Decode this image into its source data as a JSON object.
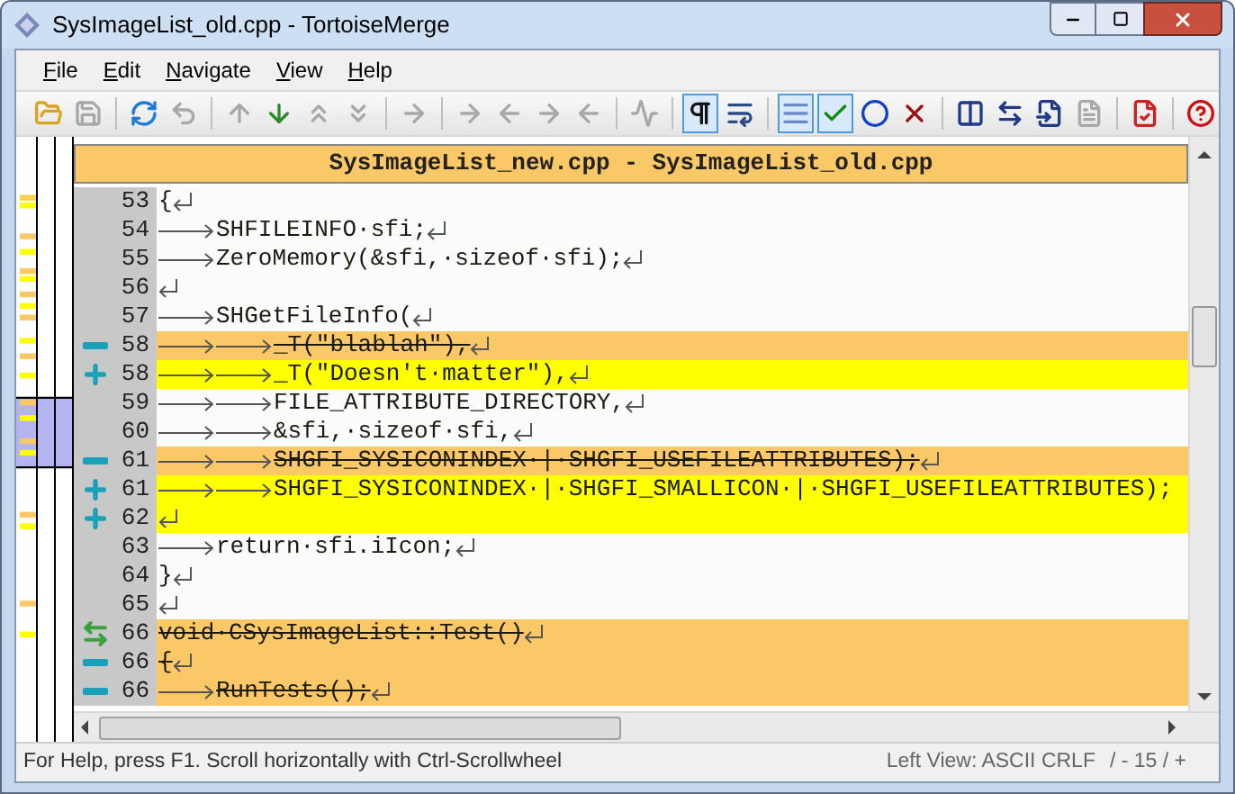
{
  "window": {
    "title": "SysImageList_old.cpp - TortoiseMerge"
  },
  "menu": [
    "File",
    "Edit",
    "Navigate",
    "View",
    "Help"
  ],
  "toolbar": [
    [
      {
        "kind": "open",
        "disabled": false,
        "selected": false
      },
      {
        "kind": "save",
        "disabled": true,
        "selected": false
      }
    ],
    [
      {
        "kind": "refresh",
        "disabled": false,
        "selected": false
      },
      {
        "kind": "undo",
        "disabled": true,
        "selected": false
      }
    ],
    [
      {
        "kind": "up",
        "disabled": true,
        "selected": false
      },
      {
        "kind": "down",
        "disabled": false,
        "selected": false
      },
      {
        "kind": "up-double",
        "disabled": true,
        "selected": false
      },
      {
        "kind": "down-double",
        "disabled": true,
        "selected": false
      }
    ],
    [
      {
        "kind": "right",
        "disabled": true,
        "selected": false
      }
    ],
    [
      {
        "kind": "right",
        "disabled": true,
        "selected": false
      },
      {
        "kind": "left",
        "disabled": true,
        "selected": false
      },
      {
        "kind": "right",
        "disabled": true,
        "selected": false
      },
      {
        "kind": "left",
        "disabled": true,
        "selected": false
      }
    ],
    [
      {
        "kind": "wave",
        "disabled": true,
        "selected": false
      }
    ],
    [
      {
        "kind": "pilcrow",
        "disabled": false,
        "selected": true
      },
      {
        "kind": "wrap",
        "disabled": false,
        "selected": false
      }
    ],
    [
      {
        "kind": "lines",
        "disabled": false,
        "selected": true
      },
      {
        "kind": "check",
        "disabled": false,
        "selected": true
      },
      {
        "kind": "circle",
        "disabled": false,
        "selected": false
      },
      {
        "kind": "cross",
        "disabled": false,
        "selected": false
      }
    ],
    [
      {
        "kind": "columns",
        "disabled": false,
        "selected": false
      },
      {
        "kind": "swap",
        "disabled": false,
        "selected": false
      },
      {
        "kind": "import",
        "disabled": false,
        "selected": false
      },
      {
        "kind": "page",
        "disabled": true,
        "selected": false
      }
    ],
    [
      {
        "kind": "doc-check",
        "disabled": false,
        "selected": false
      }
    ],
    [
      {
        "kind": "help",
        "disabled": false,
        "selected": false
      }
    ]
  ],
  "view": {
    "header": "SysImageList_new.cpp - SysImageList_old.cpp",
    "lines": [
      {
        "number": "53",
        "kind": "normal",
        "text": "{",
        "eol": true
      },
      {
        "number": "54",
        "kind": "normal",
        "text": "\tSHFILEINFO·sfi;",
        "eol": true
      },
      {
        "number": "55",
        "kind": "normal",
        "text": "\tZeroMemory(&sfi,·sizeof·sfi);",
        "eol": true
      },
      {
        "number": "56",
        "kind": "normal",
        "eol": true
      },
      {
        "number": "57",
        "kind": "normal",
        "text": "\tSHGetFileInfo(",
        "eol": true
      },
      {
        "number": "58",
        "kind": "removed",
        "text": "\t\t_T(\"blablah\"),",
        "eol": true
      },
      {
        "number": "58",
        "kind": "added",
        "text": "\t\t_T(\"Doesn't·matter\"),",
        "eol": true
      },
      {
        "number": "59",
        "kind": "normal",
        "text": "\t\tFILE_ATTRIBUTE_DIRECTORY,",
        "eol": true
      },
      {
        "number": "60",
        "kind": "normal",
        "text": "\t\t&sfi,·sizeof·sfi,",
        "eol": true
      },
      {
        "number": "61",
        "kind": "removed",
        "text": "\t\tSHGFI_SYSICONINDEX·|·SHGFI_USEFILEATTRIBUTES);",
        "eol": true
      },
      {
        "number": "61",
        "kind": "added",
        "text": "\t\tSHGFI_SYSICONINDEX·|·SHGFI_SMALLICON·|·SHGFI_USEFILEATTRIBUTES);",
        "eol": false
      },
      {
        "number": "62",
        "kind": "added",
        "eol": true
      },
      {
        "number": "63",
        "kind": "normal",
        "text": "\treturn·sfi.iIcon;",
        "eol": true
      },
      {
        "number": "64",
        "kind": "normal",
        "text": "}",
        "eol": true
      },
      {
        "number": "65",
        "kind": "normal",
        "eol": true
      },
      {
        "number": "66",
        "kind": "moved",
        "text": "void·CSysImageList::Test()",
        "eol": true
      },
      {
        "number": "66",
        "kind": "removed",
        "text": "{",
        "eol": true
      },
      {
        "number": "66",
        "kind": "removed",
        "text": "\tRunTests();",
        "eol": true
      }
    ]
  },
  "status_bar": {
    "help": "For Help, press F1. Scroll horizontally with Ctrl-Scrollwheel",
    "view": "Left View: ASCII CRLF",
    "counter": "/ - 15 / +"
  }
}
